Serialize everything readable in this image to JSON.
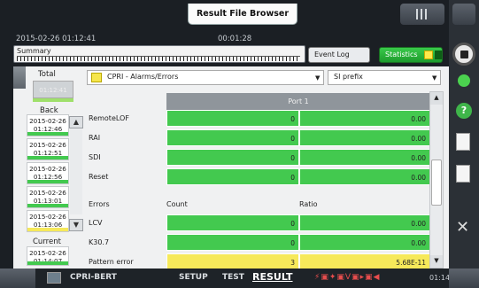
{
  "window": {
    "title": "Result File Browser"
  },
  "header": {
    "datetime": "2015-02-26 01:12:41",
    "elapsed": "00:01:28"
  },
  "summary": {
    "label": "Summary"
  },
  "tabs": {
    "event_log": "Event Log",
    "statistics": "Statistics"
  },
  "sidebar": {
    "total_label": "Total",
    "total_value": "01:12:41",
    "back_label": "Back",
    "items": [
      {
        "date": "2015-02-26",
        "time": "01:12:46",
        "color": "#43c94f"
      },
      {
        "date": "2015-02-26",
        "time": "01:12:51",
        "color": "#43c94f"
      },
      {
        "date": "2015-02-26",
        "time": "01:12:56",
        "color": "#43c94f"
      },
      {
        "date": "2015-02-26",
        "time": "01:13:01",
        "color": "#43c94f"
      },
      {
        "date": "2015-02-26",
        "time": "01:13:06",
        "color": "#f6e95a"
      }
    ],
    "current_label": "Current",
    "current_date": "2015-02-26",
    "current_time": "01:14:07"
  },
  "filters": {
    "category": "CPRI - Alarms/Errors",
    "unit": "SI prefix"
  },
  "table": {
    "port_header": "Port 1",
    "alarm_rows": [
      {
        "label": "RemoteLOF",
        "count": "0",
        "ratio": "0.00"
      },
      {
        "label": "RAI",
        "count": "0",
        "ratio": "0.00"
      },
      {
        "label": "SDI",
        "count": "0",
        "ratio": "0.00"
      },
      {
        "label": "Reset",
        "count": "0",
        "ratio": "0.00"
      }
    ],
    "col_headers": {
      "errors": "Errors",
      "count": "Count",
      "ratio": "Ratio"
    },
    "error_rows": [
      {
        "label": "LCV",
        "count": "0",
        "ratio": "0.00",
        "color": "green"
      },
      {
        "label": "K30.7",
        "count": "0",
        "ratio": "0.00",
        "color": "green"
      },
      {
        "label": "Pattern error",
        "count": "3",
        "ratio": "5.68E-11",
        "color": "yellow"
      }
    ]
  },
  "bottom_nav": {
    "app": "CPRI-BERT",
    "setup": "SETUP",
    "test": "TEST",
    "result": "RESULT",
    "clock": "01:14"
  },
  "colors": {
    "green": "#43c94f",
    "yellow": "#f6e95a",
    "accent": "#1e9c2d"
  }
}
